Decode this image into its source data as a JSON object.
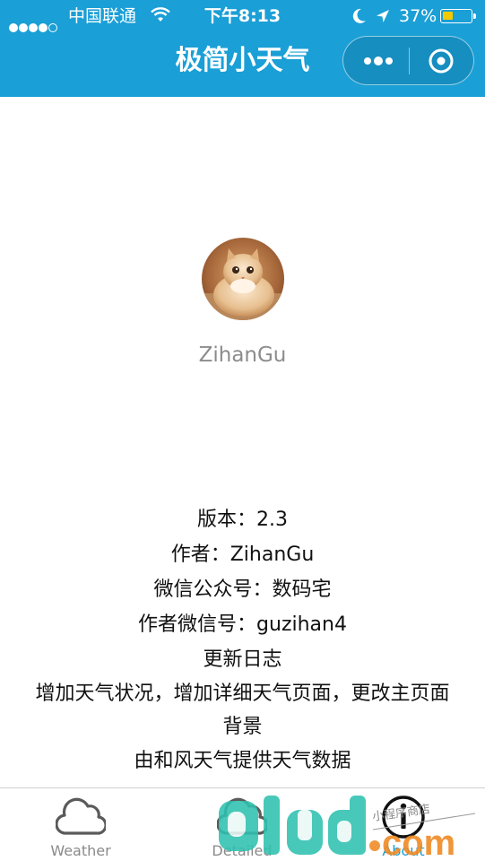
{
  "status_bar": {
    "carrier": "中国联通",
    "time": "下午8:13",
    "battery_percent": "37%",
    "signal_icon": "signal-dots-icon",
    "wifi_icon": "wifi-icon",
    "moon_icon": "do-not-disturb-moon-icon",
    "location_icon": "location-arrow-icon"
  },
  "nav": {
    "title": "极简小天气",
    "background_color": "#1a9fd6",
    "more_icon": "more-dots-icon",
    "close_icon": "close-target-icon"
  },
  "profile": {
    "avatar_icon": "cat-avatar",
    "username": "ZihanGu"
  },
  "info": {
    "version": "版本：2.3",
    "author": "作者：ZihanGu",
    "official_account": "微信公众号：数码宅",
    "author_wechat": "作者微信号：guzihan4",
    "changelog_title": "更新日志",
    "changelog_line1": "增加天气状况，增加详细天气页面，更改主页面",
    "changelog_line2": "背景",
    "data_source": "由和风天气提供天气数据"
  },
  "tabbar": {
    "tabs": [
      {
        "label": "Weather",
        "icon": "cloud-icon",
        "active": false
      },
      {
        "label": "Detailed",
        "icon": "cloud-icon",
        "active": false
      },
      {
        "label": "About",
        "icon": "info-icon",
        "active": true
      }
    ],
    "active_color": "#1a9fd6",
    "inactive_color": "#8a8a8a"
  },
  "watermark": {
    "latin": "qlud.com",
    "cjk": "小程序商店"
  }
}
